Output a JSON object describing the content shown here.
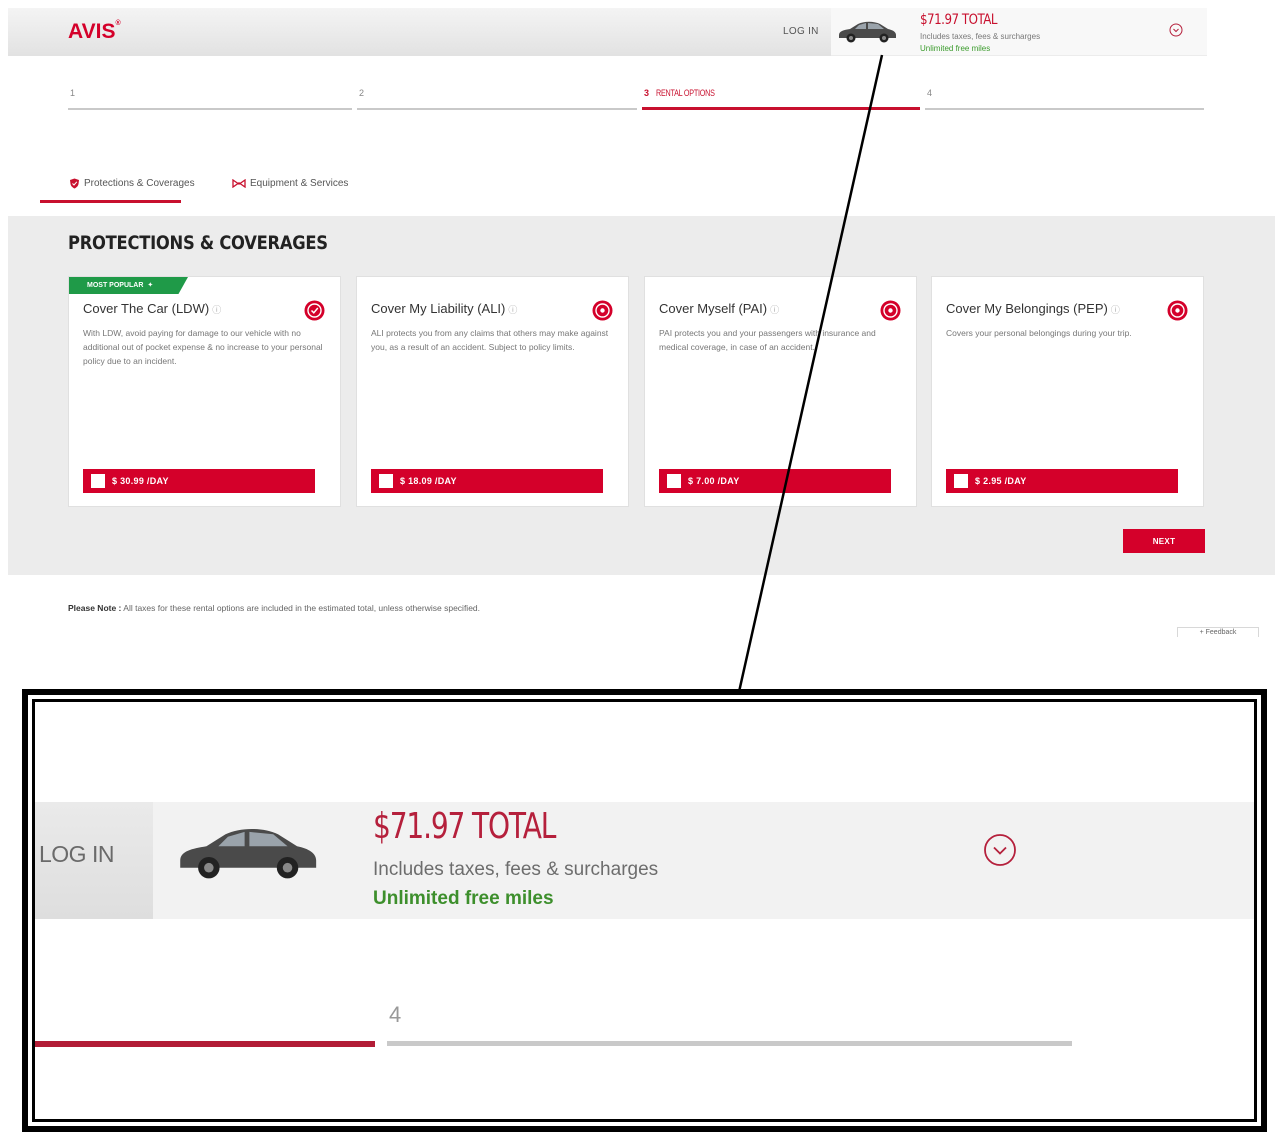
{
  "header": {
    "logo": "AVIS",
    "logo_mark": "®",
    "login": "LOG IN",
    "total": "$71.97 TOTAL",
    "taxes_note": "Includes taxes, fees & surcharges",
    "miles_note": "Unlimited free miles"
  },
  "steps": [
    {
      "number": "1",
      "label": ""
    },
    {
      "number": "2",
      "label": ""
    },
    {
      "number": "3",
      "label": "RENTAL OPTIONS",
      "active": true
    },
    {
      "number": "4",
      "label": ""
    }
  ],
  "subtabs": {
    "protections": "Protections & Coverages",
    "equipment": "Equipment & Services"
  },
  "section": {
    "title": "PROTECTIONS & COVERAGES",
    "badge": "MOST POPULAR",
    "badge_icon": "✦",
    "cards": [
      {
        "title": "Cover The Car (LDW)",
        "info": "ⓘ",
        "description": "With LDW, avoid paying for damage to our vehicle with no additional out of pocket expense & no increase to your personal policy due to an incident.",
        "price": "$ 30.99 /DAY"
      },
      {
        "title": "Cover My Liability (ALI)",
        "info": "ⓘ",
        "description": "ALI protects you from any claims that others may make against you, as a result of an accident. Subject to policy limits.",
        "price": "$ 18.09 /DAY"
      },
      {
        "title": "Cover Myself (PAI)",
        "info": "ⓘ",
        "description": "PAI protects you and your passengers with insurance and medical coverage, in case of an accident.",
        "price": "$ 7.00 /DAY"
      },
      {
        "title": "Cover My Belongings (PEP)",
        "info": "ⓘ",
        "description": "Covers your personal belongings during your trip.",
        "price": "$ 2.95 /DAY"
      }
    ],
    "next": "NEXT"
  },
  "note": {
    "label": "Please Note :",
    "text": " All taxes for these rental options are included in the estimated total, unless otherwise specified."
  },
  "feedback": "+ Feedback",
  "zoom": {
    "login": "LOG IN",
    "total": "$71.97 TOTAL",
    "taxes_note": "Includes taxes, fees & surcharges",
    "miles_note": "Unlimited free miles",
    "step_number": "4"
  },
  "colors": {
    "brand_red": "#d4002a",
    "badge_green": "#1f9a48",
    "miles_green": "#3a9b2c",
    "section_bg": "#ececec"
  },
  "icons": [
    "car-image",
    "chevron-down-circle-icon",
    "shield-icon",
    "equipment-icon",
    "coverage-icon",
    "info-icon",
    "star-icon"
  ]
}
